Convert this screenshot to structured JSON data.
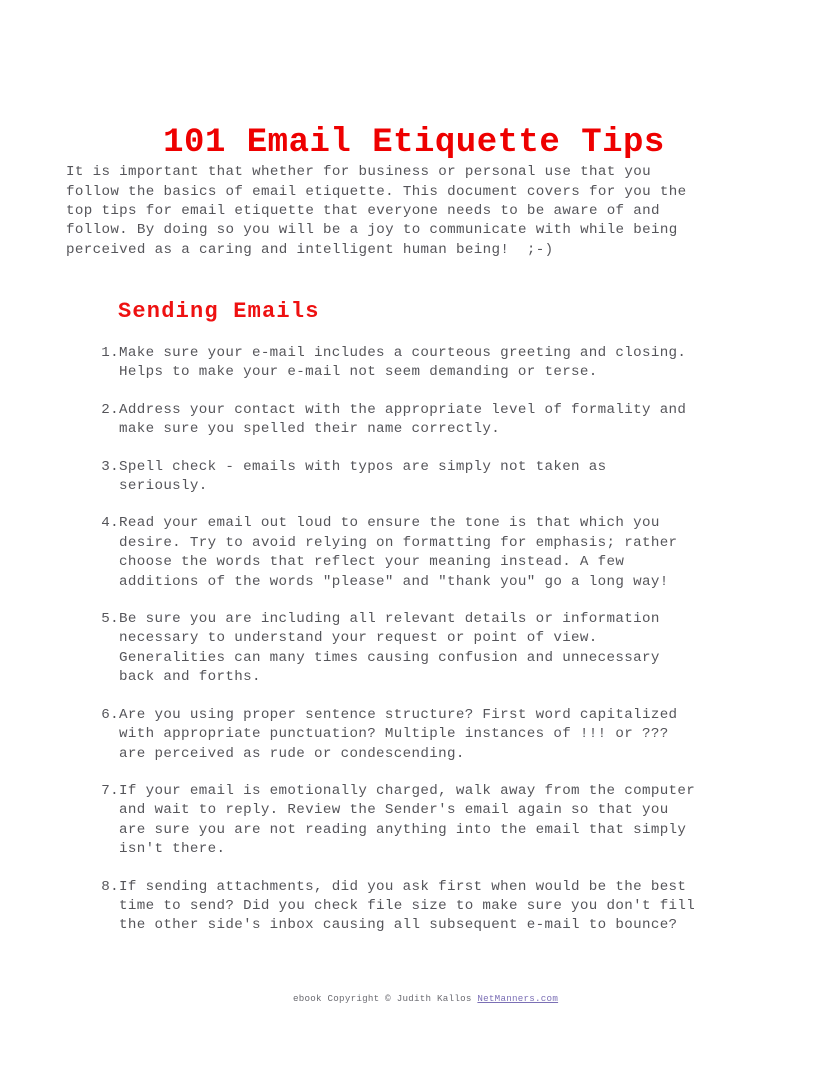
{
  "document": {
    "title": "101 Email Etiquette Tips",
    "intro": "It is important that whether for business or personal use that you\nfollow the basics of email etiquette. This document covers for you the\ntop tips for email etiquette that everyone needs to be aware of and\nfollow. By doing so you will be a joy to communicate with while being\nperceived as a caring and intelligent human being!  ;-)",
    "section_heading": "Sending Emails",
    "tips": [
      {
        "number": "1.",
        "text": "Make sure your e-mail includes a courteous greeting and closing.\nHelps to make your e-mail not seem demanding or terse."
      },
      {
        "number": "2.",
        "text": "Address your contact with the appropriate level of formality and\nmake sure you spelled their name correctly."
      },
      {
        "number": "3.",
        "text": "Spell check - emails with typos are simply not taken as\nseriously."
      },
      {
        "number": "4.",
        "text": "Read your email out loud to ensure the tone is that which you\ndesire. Try to avoid relying on formatting for emphasis; rather\nchoose the words that reflect your meaning instead. A few\nadditions of the words \"please\" and \"thank you\" go a long way!"
      },
      {
        "number": "5.",
        "text": "Be sure you are including all relevant details or information\nnecessary to understand your request or point of view.\nGeneralities can many times causing confusion and unnecessary\nback and forths."
      },
      {
        "number": "6.",
        "text": "Are you using proper sentence structure? First word capitalized\nwith appropriate punctuation? Multiple instances of !!! or ???\nare perceived as rude or condescending."
      },
      {
        "number": "7.",
        "text": "If your email is emotionally charged, walk away from the computer\nand wait to reply. Review the Sender's email again so that you\nare sure you are not reading anything into the email that simply\nisn't there."
      },
      {
        "number": "8.",
        "text": "If sending attachments, did you ask first when would be the best\ntime to send? Did you check file size to make sure you don't fill\nthe other side's inbox causing all subsequent e-mail to bounce?"
      }
    ],
    "footer": {
      "copyright": "ebook Copyright © Judith Kallos ",
      "link_label": "NetManners.com"
    },
    "colors": {
      "title_red": "#ee0000",
      "heading_red": "#ee1111",
      "body_gray": "#55555a",
      "link_purple": "#7b6fb5",
      "page_background": "#ffffff"
    }
  }
}
